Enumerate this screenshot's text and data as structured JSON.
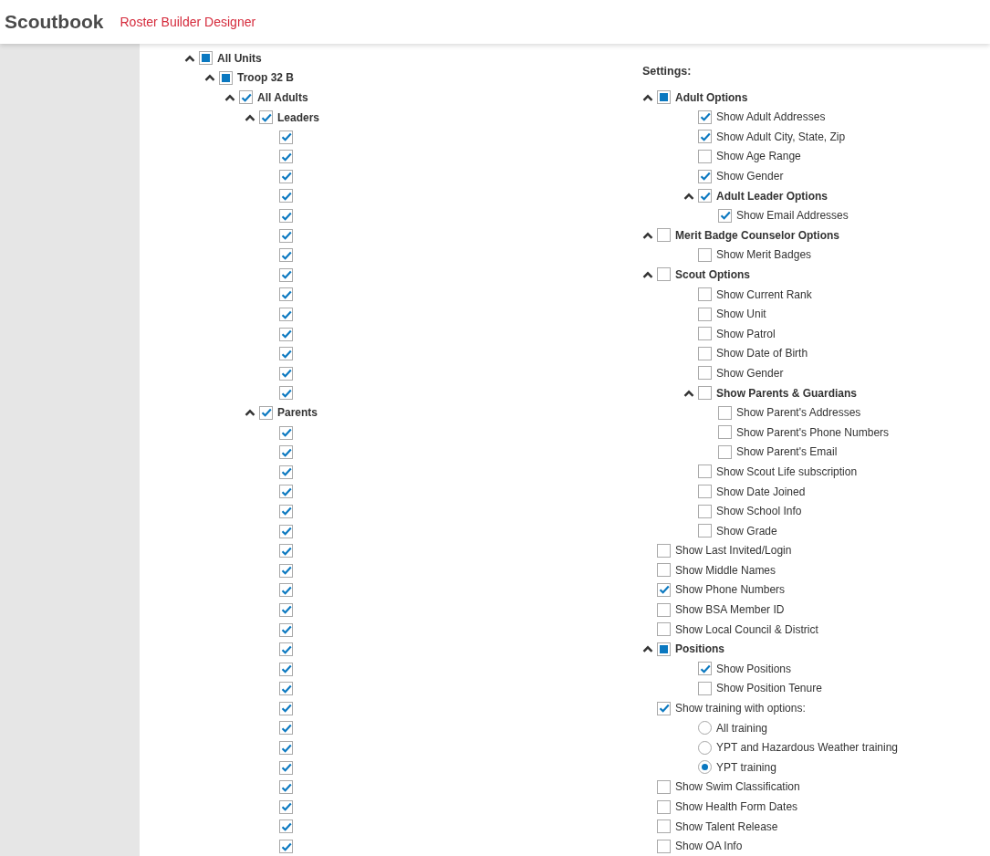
{
  "header": {
    "title": "Scoutbook",
    "subtitle": "Roster Builder Designer"
  },
  "tree": [
    {
      "label": "All Units",
      "expanded": true,
      "checked": false,
      "partial": true,
      "children": [
        {
          "label": "Troop 32 B",
          "expanded": true,
          "checked": false,
          "partial": true,
          "children": [
            {
              "label": "All Adults",
              "expanded": true,
              "checked": true,
              "children": [
                {
                  "label": "Leaders",
                  "expanded": true,
                  "checked": true,
                  "children": [
                    {
                      "checked": true
                    },
                    {
                      "checked": true
                    },
                    {
                      "checked": true
                    },
                    {
                      "checked": true
                    },
                    {
                      "checked": true
                    },
                    {
                      "checked": true
                    },
                    {
                      "checked": true
                    },
                    {
                      "checked": true
                    },
                    {
                      "checked": true
                    },
                    {
                      "checked": true
                    },
                    {
                      "checked": true
                    },
                    {
                      "checked": true
                    },
                    {
                      "checked": true
                    },
                    {
                      "checked": true
                    }
                  ]
                },
                {
                  "label": "Parents",
                  "expanded": true,
                  "checked": true,
                  "children": [
                    {
                      "checked": true
                    },
                    {
                      "checked": true
                    },
                    {
                      "checked": true
                    },
                    {
                      "checked": true
                    },
                    {
                      "checked": true
                    },
                    {
                      "checked": true
                    },
                    {
                      "checked": true
                    },
                    {
                      "checked": true
                    },
                    {
                      "checked": true
                    },
                    {
                      "checked": true
                    },
                    {
                      "checked": true
                    },
                    {
                      "checked": true
                    },
                    {
                      "checked": true
                    },
                    {
                      "checked": true
                    },
                    {
                      "checked": true
                    },
                    {
                      "checked": true
                    },
                    {
                      "checked": true
                    },
                    {
                      "checked": true
                    },
                    {
                      "checked": true
                    },
                    {
                      "checked": true
                    },
                    {
                      "checked": true
                    },
                    {
                      "checked": true
                    }
                  ]
                }
              ]
            }
          ]
        }
      ]
    }
  ],
  "settings": {
    "title": "Settings:",
    "items": [
      {
        "label": "Adult Options",
        "expanded": true,
        "checked": false,
        "partial": true,
        "children": [
          {
            "label": "Show Adult Addresses",
            "checked": true
          },
          {
            "label": "Show Adult City, State, Zip",
            "checked": true
          },
          {
            "label": "Show Age Range",
            "checked": false
          },
          {
            "label": "Show Gender",
            "checked": true
          },
          {
            "label": "Adult Leader Options",
            "expanded": true,
            "checked": true,
            "children": [
              {
                "label": "Show Email Addresses",
                "checked": true
              }
            ]
          }
        ]
      },
      {
        "label": "Merit Badge Counselor Options",
        "expanded": true,
        "checked": false,
        "children": [
          {
            "label": "Show Merit Badges",
            "checked": false
          }
        ]
      },
      {
        "label": "Scout Options",
        "expanded": true,
        "checked": false,
        "children": [
          {
            "label": "Show Current Rank",
            "checked": false
          },
          {
            "label": "Show Unit",
            "checked": false
          },
          {
            "label": "Show Patrol",
            "checked": false
          },
          {
            "label": "Show Date of Birth",
            "checked": false
          },
          {
            "label": "Show Gender",
            "checked": false
          },
          {
            "label": "Show Parents & Guardians",
            "expanded": true,
            "checked": false,
            "children": [
              {
                "label": "Show Parent's Addresses",
                "checked": false
              },
              {
                "label": "Show Parent's Phone Numbers",
                "checked": false
              },
              {
                "label": "Show Parent's Email",
                "checked": false
              }
            ]
          },
          {
            "label": "Show Scout Life subscription",
            "checked": false
          },
          {
            "label": "Show Date Joined",
            "checked": false
          },
          {
            "label": "Show School Info",
            "checked": false
          },
          {
            "label": "Show Grade",
            "checked": false
          }
        ]
      },
      {
        "label": "Show Last Invited/Login",
        "checked": false
      },
      {
        "label": "Show Middle Names",
        "checked": false
      },
      {
        "label": "Show Phone Numbers",
        "checked": true
      },
      {
        "label": "Show BSA Member ID",
        "checked": false
      },
      {
        "label": "Show Local Council & District",
        "checked": false
      },
      {
        "label": "Positions",
        "expanded": true,
        "checked": false,
        "partial": true,
        "children": [
          {
            "label": "Show Positions",
            "checked": true
          },
          {
            "label": "Show Position Tenure",
            "checked": false
          }
        ]
      },
      {
        "label": "Show training with options:",
        "checked": true,
        "options": [
          {
            "label": "All training",
            "selected": false
          },
          {
            "label": "YPT and Hazardous Weather training",
            "selected": false
          },
          {
            "label": "YPT training",
            "selected": true
          }
        ]
      },
      {
        "label": "Show Swim Classification",
        "checked": false
      },
      {
        "label": "Show Health Form Dates",
        "checked": false
      },
      {
        "label": "Show Talent Release",
        "checked": false
      },
      {
        "label": "Show OA Info",
        "checked": false
      }
    ]
  }
}
